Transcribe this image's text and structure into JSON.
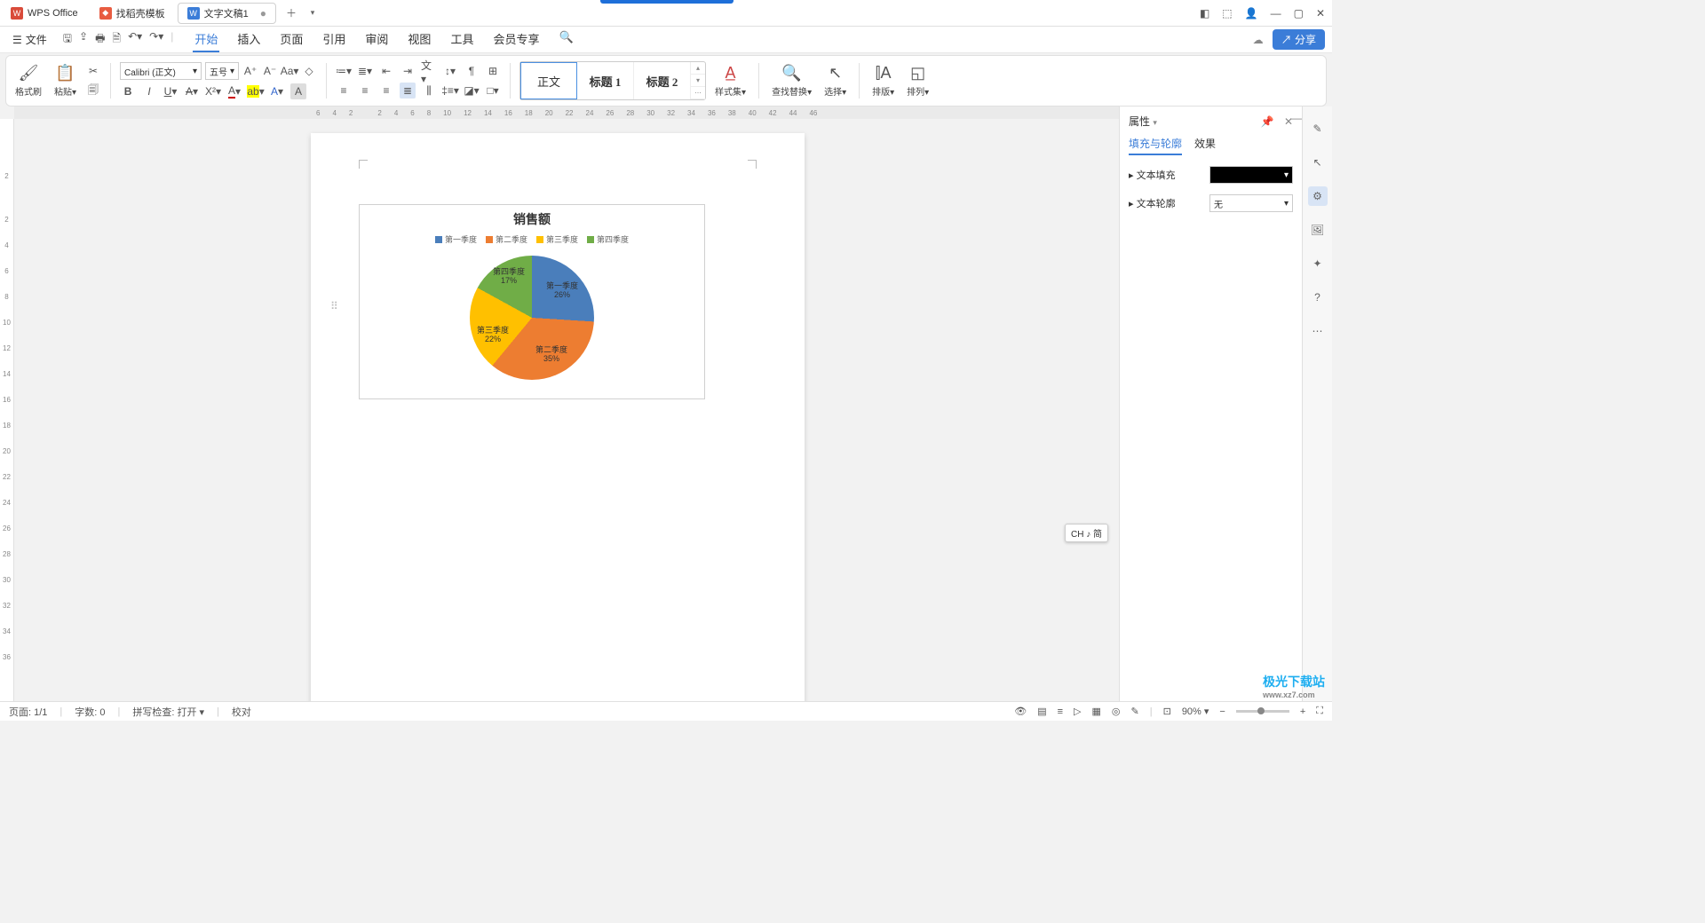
{
  "titlebar": {
    "app_tab": "WPS Office",
    "template_tab": "找稻壳模板",
    "doc_tab": "文字文稿1"
  },
  "menubar": {
    "file": "文件",
    "tabs": [
      "开始",
      "插入",
      "页面",
      "引用",
      "审阅",
      "视图",
      "工具",
      "会员专享"
    ],
    "share": "分享"
  },
  "ribbon": {
    "format_painter": "格式刷",
    "paste": "粘贴",
    "font_name": "Calibri (正文)",
    "font_size": "五号",
    "styles": {
      "normal": "正文",
      "h1": "标题 1",
      "h2": "标题 2",
      "styleset": "样式集"
    },
    "find_replace": "查找替换",
    "select": "选择",
    "layout": "排版",
    "arrange": "排列"
  },
  "ruler_h": [
    "6",
    "4",
    "2",
    "",
    "2",
    "4",
    "6",
    "8",
    "10",
    "12",
    "14",
    "16",
    "18",
    "20",
    "22",
    "24",
    "26",
    "28",
    "30",
    "32",
    "34",
    "36",
    "38",
    "40",
    "42",
    "44",
    "46"
  ],
  "ruler_v": [
    "",
    "2",
    "",
    "2",
    "4",
    "6",
    "8",
    "10",
    "12",
    "14",
    "16",
    "18",
    "20",
    "22",
    "24",
    "26",
    "28",
    "30",
    "32",
    "34",
    "36"
  ],
  "chart_data": {
    "type": "pie",
    "title": "销售额",
    "legend": [
      "第一季度",
      "第二季度",
      "第三季度",
      "第四季度"
    ],
    "series": [
      {
        "name": "第一季度",
        "value": 26,
        "color": "#4a7ebb"
      },
      {
        "name": "第二季度",
        "value": 35,
        "color": "#ed7d31"
      },
      {
        "name": "第三季度",
        "value": 22,
        "color": "#ffc000"
      },
      {
        "name": "第四季度",
        "value": 17,
        "color": "#70ad47"
      }
    ],
    "labels": {
      "q1": "第一季度\n26%",
      "q2": "第二季度\n35%",
      "q3": "第三季度\n22%",
      "q4": "第四季度\n17%"
    }
  },
  "side": {
    "title": "属性",
    "tab_fill": "填充与轮廓",
    "tab_effect": "效果",
    "text_fill": "文本填充",
    "text_outline": "文本轮廓",
    "outline_value": "无"
  },
  "ime": "CH ♪ 简",
  "status": {
    "page": "页面: 1/1",
    "words": "字数: 0",
    "spell": "拼写检查: 打开",
    "proof": "校对",
    "zoom": "90%"
  },
  "watermark": {
    "brand": "极光下载站",
    "url": "www.xz7.com"
  }
}
